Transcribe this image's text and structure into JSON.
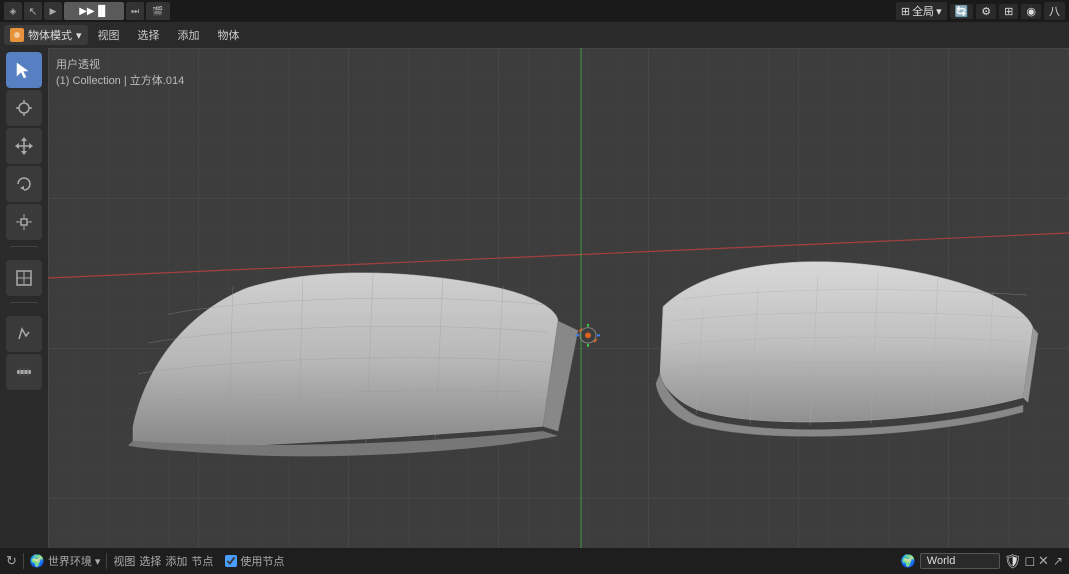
{
  "topbar": {
    "mode_icon": "▶",
    "right_items": [
      {
        "label": "全局",
        "icon": "⊞"
      },
      {
        "label": "🔄",
        "icon": ""
      },
      {
        "label": "⚙",
        "icon": ""
      },
      {
        "label": "⊞",
        "icon": ""
      },
      {
        "label": "◉",
        "icon": ""
      },
      {
        "label": "八",
        "icon": ""
      }
    ]
  },
  "headerbar": {
    "mode_label": "物体模式",
    "menu_items": [
      "视图",
      "选择",
      "添加",
      "物体"
    ]
  },
  "viewport_info": {
    "line1": "用户透视",
    "line2": "(1) Collection | 立方体.014"
  },
  "toolbar": {
    "buttons": [
      {
        "icon": "↖",
        "label": "select",
        "active": true
      },
      {
        "icon": "⊕",
        "label": "cursor"
      },
      {
        "icon": "✥",
        "label": "move"
      },
      {
        "icon": "↻",
        "label": "rotate"
      },
      {
        "icon": "⊡",
        "label": "scale"
      },
      {
        "icon": "⊞",
        "label": "transform"
      },
      {
        "icon": "✏",
        "label": "annotate"
      },
      {
        "icon": "📏",
        "label": "measure"
      }
    ]
  },
  "statusbar": {
    "left_items": [
      {
        "icon": "↻",
        "label": ""
      },
      {
        "icon": "🌍",
        "label": "世界环境"
      },
      {
        "label": "视图"
      },
      {
        "label": "选择"
      },
      {
        "label": "添加"
      },
      {
        "label": "节点"
      }
    ],
    "checkbox_label": "使用节点",
    "world_label": "World",
    "right_icons": [
      "🌍",
      "□",
      "✕",
      "↗"
    ]
  },
  "shapes": {
    "wing_left": {
      "color": "#b8b8b8",
      "shadow_color": "#888"
    },
    "wing_right": {
      "color": "#c0c0c0",
      "shadow_color": "#999"
    }
  }
}
